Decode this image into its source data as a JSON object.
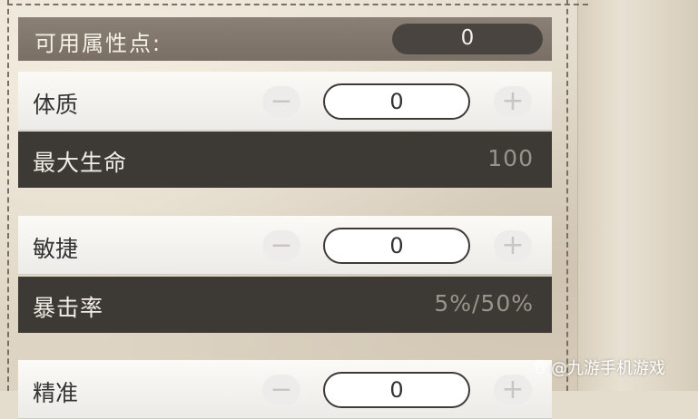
{
  "header": {
    "label": "可用属性点:",
    "value": "0"
  },
  "stats": [
    {
      "name": "体质",
      "minus": "−",
      "value": "0",
      "plus": "+",
      "derived_name": "最大生命",
      "derived_value": "100"
    },
    {
      "name": "敏捷",
      "minus": "−",
      "value": "0",
      "plus": "+",
      "derived_name": "暴击率",
      "derived_value": "5%/50%"
    },
    {
      "name": "精准",
      "minus": "−",
      "value": "0",
      "plus": "+"
    }
  ],
  "watermark": {
    "text": "@九游手机游戏",
    "icon": "paw-icon"
  },
  "colors": {
    "header_bg": "#7a6f64",
    "value_pill": "#4a4440",
    "derived_bg": "#3d3935",
    "derived_value_text": "#9a938b",
    "parchment": "#e4dccd"
  }
}
